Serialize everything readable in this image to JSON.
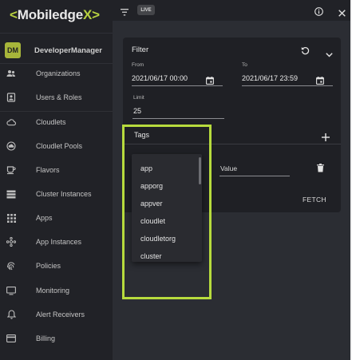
{
  "app": {
    "logo_left": "<",
    "logo_text": "Mobiledge",
    "logo_right": "X>"
  },
  "profile": {
    "initials": "DM",
    "name": "DeveloperManager"
  },
  "sidebar": {
    "items": [
      {
        "label": "Organizations",
        "icon": "people-icon"
      },
      {
        "label": "Users & Roles",
        "icon": "user-badge-icon"
      },
      {
        "label": "Cloudlets",
        "icon": "cloud-icon"
      },
      {
        "label": "Cloudlet Pools",
        "icon": "cloud-pool-icon"
      },
      {
        "label": "Flavors",
        "icon": "cup-icon"
      },
      {
        "label": "Cluster Instances",
        "icon": "storage-icon"
      },
      {
        "label": "Apps",
        "icon": "apps-grid-icon"
      },
      {
        "label": "App Instances",
        "icon": "hub-icon"
      },
      {
        "label": "Policies",
        "icon": "fingerprint-icon"
      },
      {
        "label": "Monitoring",
        "icon": "monitor-icon"
      },
      {
        "label": "Alert Receivers",
        "icon": "bell-icon"
      },
      {
        "label": "Billing",
        "icon": "card-icon"
      }
    ]
  },
  "topbar": {
    "live": "LIVE"
  },
  "filter": {
    "title": "Filter",
    "from_label": "From",
    "from_value": "2021/06/17 00:00",
    "to_label": "To",
    "to_value": "2021/06/17 23:59",
    "limit_label": "Limit",
    "limit_value": "25",
    "tags_title": "Tags",
    "value_placeholder": "Value",
    "fetch_label": "FETCH"
  },
  "dropdown": {
    "options": [
      "app",
      "apporg",
      "appver",
      "cloudlet",
      "cloudletorg",
      "cluster"
    ]
  },
  "colors": {
    "accent": "#b7db3d",
    "sidebar_bg": "#212227",
    "panel_bg": "#1f2025",
    "page_bg": "#2b2d33"
  }
}
